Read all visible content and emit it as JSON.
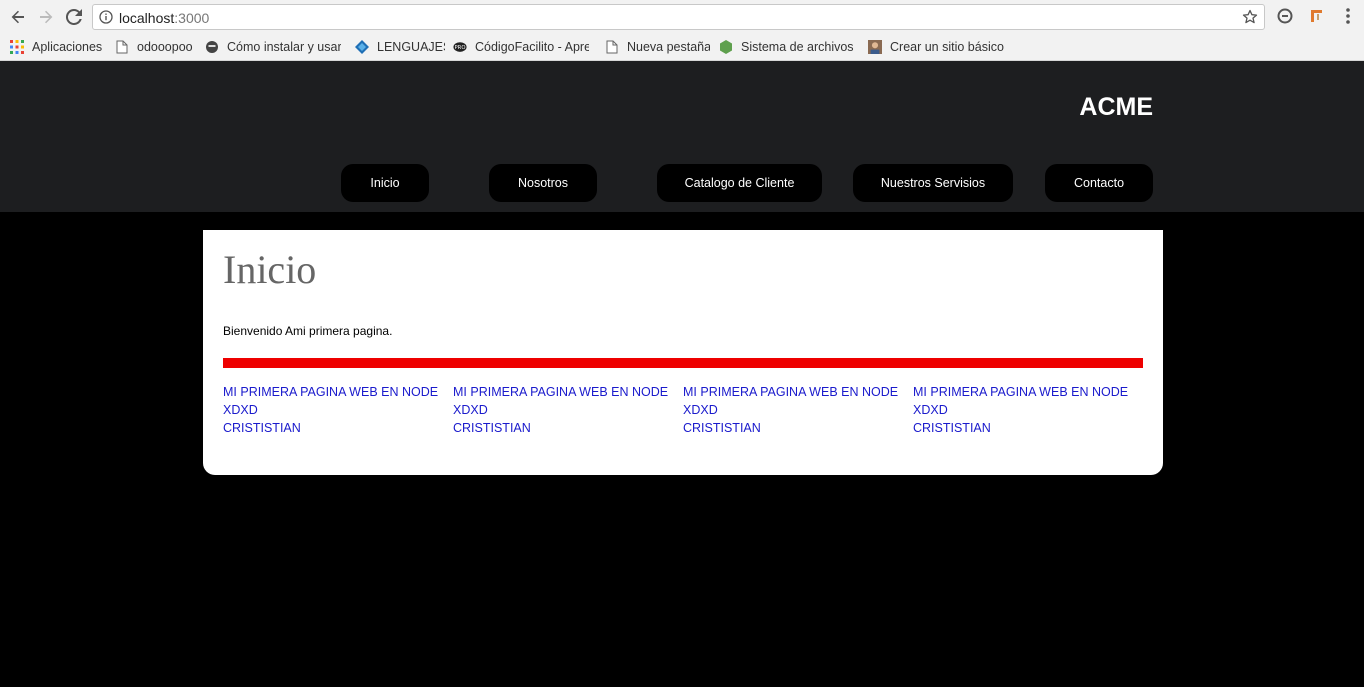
{
  "browser": {
    "url_host": "localhost",
    "url_port": ":3000",
    "bookmarks": [
      {
        "label": "Aplicaciones",
        "icon": "apps-grid-icon"
      },
      {
        "label": "odooopoo",
        "icon": "page-icon"
      },
      {
        "label": "Cómo instalar y usar c",
        "icon": "site-favicon-icon"
      },
      {
        "label": "LENGUAJES",
        "icon": "diamond-favicon-icon"
      },
      {
        "label": "CódigoFacilito - Apre",
        "icon": "pro-favicon-icon"
      },
      {
        "label": "Nueva pestaña",
        "icon": "page-icon"
      },
      {
        "label": "Sistema de archivos |",
        "icon": "nodejs-favicon-icon"
      },
      {
        "label": "Crear un sitio básico",
        "icon": "avatar-favicon-icon"
      }
    ]
  },
  "site": {
    "brand": "ACME",
    "nav": [
      "Inicio",
      "Nosotros",
      "Catalogo de Cliente",
      "Nuestros Servisios",
      "Contacto"
    ]
  },
  "main": {
    "title": "Inicio",
    "welcome": "Bienvenido Ami primera pagina.",
    "columns": [
      {
        "title": "MI PRIMERA PAGINA WEB EN NODE",
        "line2": "XDXD",
        "line3": "CRISTISTIAN"
      },
      {
        "title": "MI PRIMERA PAGINA WEB EN NODE",
        "line2": "XDXD",
        "line3": "CRISTISTIAN"
      },
      {
        "title": "MI PRIMERA PAGINA WEB EN NODE",
        "line2": "XDXD",
        "line3": "CRISTISTIAN"
      },
      {
        "title": "MI PRIMERA PAGINA WEB EN NODE",
        "line2": "XDXD",
        "line3": "CRISTISTIAN"
      }
    ]
  },
  "colors": {
    "page_bg": "#000000",
    "header_bg": "#1d1e20",
    "accent_bar": "#ee0000",
    "link": "#1a1acc"
  }
}
